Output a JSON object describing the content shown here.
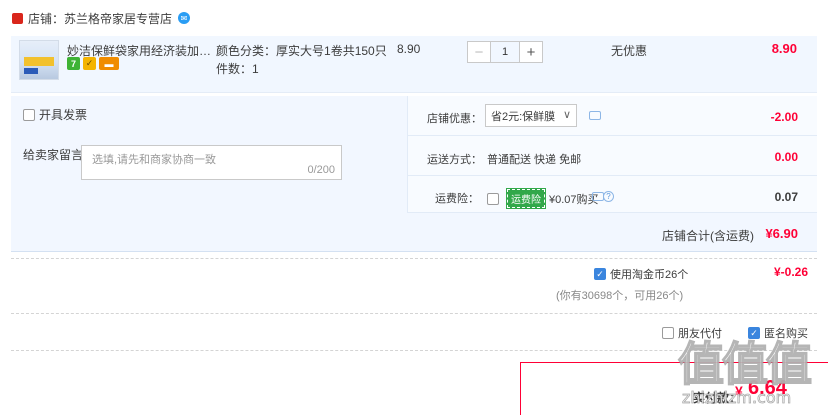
{
  "shop": {
    "prefix": "店铺：",
    "name": "苏兰格帝家居专营店"
  },
  "item": {
    "title": "妙洁保鲜袋家用经济装加厚专用…",
    "sku_label": "颜色分类：",
    "sku_value": "厚实大号1卷共150只",
    "qty_label": "件数：",
    "qty_value": "1",
    "unit_price": "8.90",
    "quantity": "1",
    "minus": "−",
    "plus": "+",
    "discount": "无优惠",
    "total": "8.90"
  },
  "options": {
    "invoice_label": "开具发票",
    "message_label": "给卖家留言：",
    "message_placeholder": "选填,请先和商家协商一致",
    "message_count": "0/200",
    "shop_coupon_label": "店铺优惠：",
    "shop_coupon_value": "省2元:保鲜膜",
    "shop_coupon_amount": "-2.00",
    "delivery_label": "运送方式：",
    "delivery_value": "普通配送 快递 免邮",
    "delivery_amount": "0.00",
    "insurance_label": "运费险：",
    "insurance_badge": "运费险",
    "insurance_text": "¥0.07购买",
    "insurance_amount": "0.07",
    "shop_total_label": "店铺合计(含运费)",
    "shop_total_value": "¥6.90"
  },
  "coins": {
    "label": "使用淘金币26个",
    "sub": "(你有30698个，可用26个)",
    "value": "¥-0.26"
  },
  "checkout": {
    "friend_pay": "朋友代付",
    "anonymous": "匿名购买",
    "pay_label": "实付款：",
    "pay_currency": "¥",
    "pay_amount": "6.64"
  },
  "watermark": {
    "glyphs": "值值值",
    "url": "zhizhizm.com"
  },
  "colors": {
    "accent_red": "#ff0036",
    "row_bg": "#f1f7ff",
    "check_blue": "#3a85de"
  },
  "icons": {
    "shop_badge": "shop-badge-icon",
    "wangwang": "wangwang-chat-icon",
    "select_chevron": "chevron-down-icon",
    "message": "message-bubble-icon",
    "help": "question-icon"
  }
}
